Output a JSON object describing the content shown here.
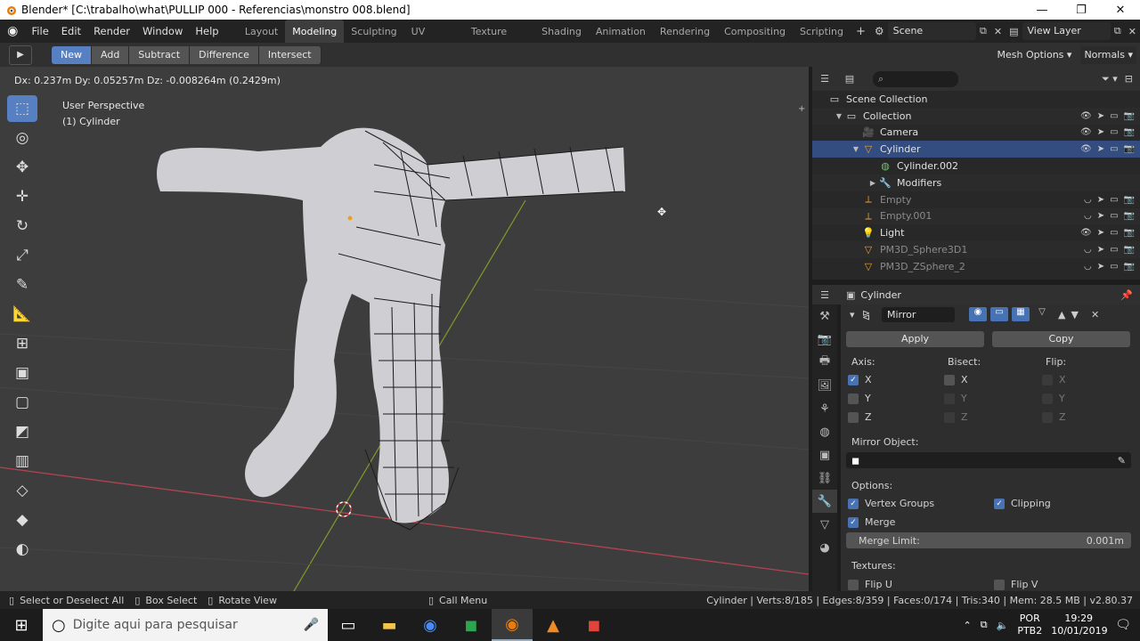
{
  "window": {
    "title": "Blender* [C:\\trabalho\\what\\PULLIP 000 - Referencias\\monstro 008.blend]",
    "minimize": "—",
    "maximize": "❐",
    "close": "✕"
  },
  "menu": [
    "File",
    "Edit",
    "Render",
    "Window",
    "Help"
  ],
  "workspaces": [
    "Layout",
    "Modeling",
    "Sculpting",
    "UV Editing",
    "Texture Paint",
    "Shading",
    "Animation",
    "Rendering",
    "Compositing",
    "Scripting"
  ],
  "active_workspace": "Modeling",
  "scene": {
    "label": "Scene",
    "view_layer": "View Layer"
  },
  "tool_header": {
    "modes": [
      "New",
      "Add",
      "Subtract",
      "Difference",
      "Intersect"
    ],
    "active_mode": "New",
    "mesh_options": "Mesh Options",
    "orientation": "Normals"
  },
  "viewport": {
    "transform_info": "Dx: 0.237m   Dy: 0.05257m   Dz: -0.008264m (0.2429m)",
    "perspective": "User Perspective",
    "object": "(1) Cylinder"
  },
  "outliner": {
    "items": [
      {
        "label": "Scene Collection",
        "icon": "scene-collection-icon",
        "indent": 0,
        "dim": false,
        "selected": false
      },
      {
        "label": "Collection",
        "icon": "collection-icon",
        "indent": 1,
        "dim": false,
        "selected": false
      },
      {
        "label": "Camera",
        "icon": "camera-icon",
        "indent": 2,
        "dim": false,
        "selected": false
      },
      {
        "label": "Cylinder",
        "icon": "mesh-object-icon",
        "indent": 2,
        "dim": false,
        "selected": true
      },
      {
        "label": "Cylinder.002",
        "icon": "mesh-data-icon",
        "indent": 3,
        "dim": false,
        "selected": false
      },
      {
        "label": "Modifiers",
        "icon": "wrench-icon",
        "indent": 3,
        "dim": false,
        "selected": false
      },
      {
        "label": "Empty",
        "icon": "empty-icon",
        "indent": 2,
        "dim": true,
        "selected": false
      },
      {
        "label": "Empty.001",
        "icon": "empty-icon",
        "indent": 2,
        "dim": true,
        "selected": false
      },
      {
        "label": "Light",
        "icon": "light-icon",
        "indent": 2,
        "dim": false,
        "selected": false
      },
      {
        "label": "PM3D_Sphere3D1",
        "icon": "mesh-object-icon",
        "indent": 2,
        "dim": true,
        "selected": false
      },
      {
        "label": "PM3D_ZSphere_2",
        "icon": "mesh-object-icon",
        "indent": 2,
        "dim": true,
        "selected": false
      }
    ]
  },
  "properties": {
    "object_name": "Cylinder",
    "modifier_name": "Mirror",
    "apply": "Apply",
    "copy": "Copy",
    "axis_label": "Axis:",
    "bisect_label": "Bisect:",
    "flip_label": "Flip:",
    "axes": [
      "X",
      "Y",
      "Z"
    ],
    "axis_checked": [
      true,
      false,
      false
    ],
    "mirror_object_label": "Mirror Object:",
    "options_label": "Options:",
    "vertex_groups": "Vertex Groups",
    "clipping": "Clipping",
    "merge": "Merge",
    "merge_limit_label": "Merge Limit:",
    "merge_limit_value": "0.001m",
    "textures_label": "Textures:",
    "flip_u": "Flip U",
    "flip_v": "Flip V"
  },
  "statusbar": {
    "select": "Select or Deselect All",
    "box_select": "Box Select",
    "rotate": "Rotate View",
    "call_menu": "Call Menu",
    "stats": "Cylinder | Verts:8/185 | Edges:8/359 | Faces:0/174 | Tris:340 | Mem: 28.5 MB | v2.80.37"
  },
  "taskbar": {
    "search_placeholder": "Digite aqui para pesquisar",
    "lang1": "POR",
    "lang2": "PTB2",
    "time": "19:29",
    "date": "10/01/2019"
  }
}
